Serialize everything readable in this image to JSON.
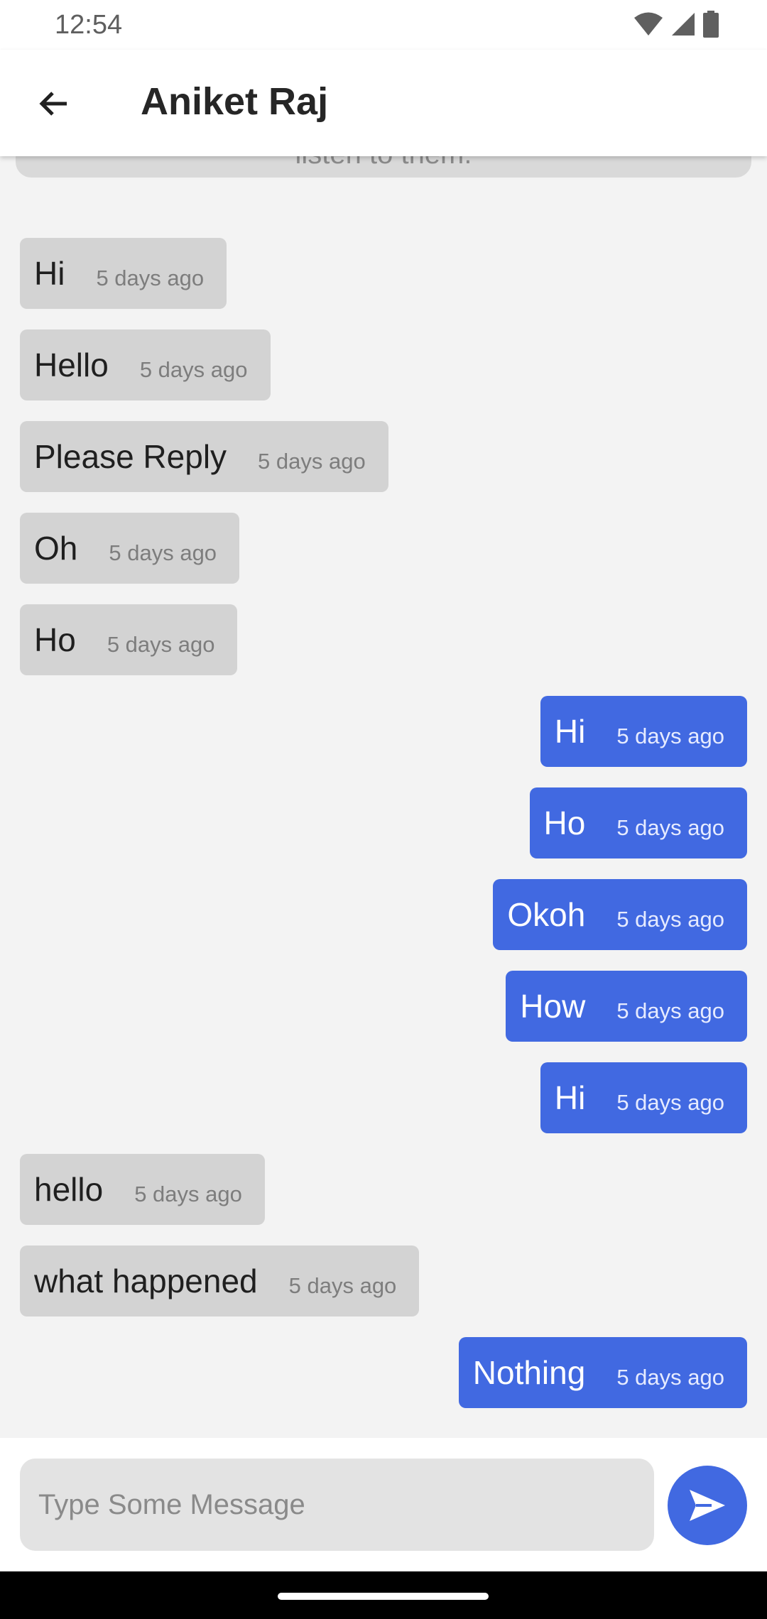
{
  "status_bar": {
    "time": "12:54",
    "icons": [
      "wifi-icon",
      "signal-icon",
      "battery-icon"
    ]
  },
  "header": {
    "back_icon": "arrow-left-icon",
    "title": "Aniket Raj"
  },
  "partial_message": {
    "text": "listen to them."
  },
  "messages": [
    {
      "direction": "in",
      "text": "Hi",
      "time": "5 days ago"
    },
    {
      "direction": "in",
      "text": "Hello",
      "time": "5 days ago"
    },
    {
      "direction": "in",
      "text": "Please Reply",
      "time": "5 days ago"
    },
    {
      "direction": "in",
      "text": "Oh",
      "time": "5 days ago"
    },
    {
      "direction": "in",
      "text": "Ho",
      "time": "5 days ago"
    },
    {
      "direction": "out",
      "text": "Hi",
      "time": "5 days ago"
    },
    {
      "direction": "out",
      "text": "Ho",
      "time": "5 days ago"
    },
    {
      "direction": "out",
      "text": "Okoh",
      "time": "5 days ago"
    },
    {
      "direction": "out",
      "text": "How",
      "time": "5 days ago"
    },
    {
      "direction": "out",
      "text": "Hi",
      "time": "5 days ago"
    },
    {
      "direction": "in",
      "text": "hello",
      "time": "5 days ago"
    },
    {
      "direction": "in",
      "text": "what happened",
      "time": "5 days ago"
    },
    {
      "direction": "out",
      "text": "Nothing",
      "time": "5 days ago"
    }
  ],
  "composer": {
    "placeholder": "Type Some Message",
    "value": "",
    "send_icon": "send-icon"
  },
  "colors": {
    "outgoing_bubble": "#4169e1",
    "incoming_bubble": "#d3d3d3",
    "background": "#f3f3f3"
  }
}
